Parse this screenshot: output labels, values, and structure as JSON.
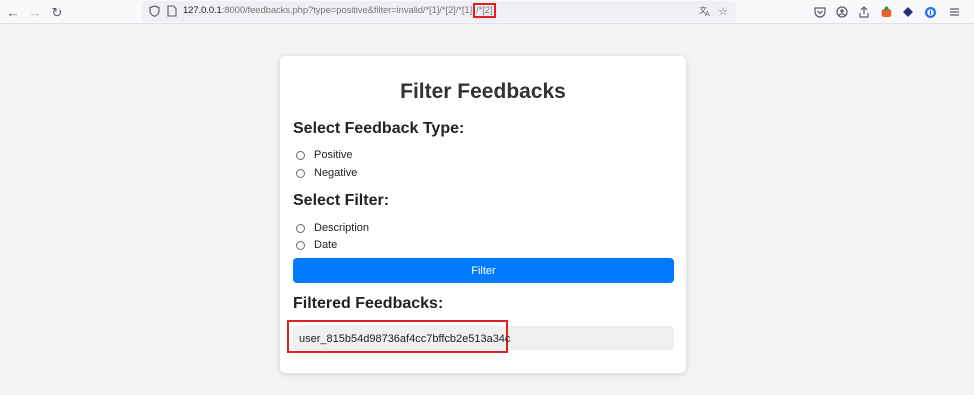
{
  "browser": {
    "url_host": "127.0.0.1",
    "url_rest": ":8000/feedbacks.php?type=positive&filter=invalid/*[1]/*[2]/*[1]",
    "url_highlight": "/*[2]",
    "icons": {
      "back": "arrow-left-icon",
      "forward": "arrow-right-icon",
      "reload": "reload-icon",
      "shield": "shield-icon",
      "page": "page-icon",
      "translate": "translate-icon",
      "bookmark": "star-icon"
    }
  },
  "form": {
    "title": "Filter Feedbacks",
    "type_heading": "Select Feedback Type:",
    "type_options": [
      "Positive",
      "Negative"
    ],
    "filter_heading": "Select Filter:",
    "filter_options": [
      "Description",
      "Date"
    ],
    "filter_button": "Filter",
    "results_heading": "Filtered Feedbacks:",
    "results": [
      "user_815b54d98736af4cc7bffcb2e513a34c"
    ]
  },
  "colors": {
    "accent": "#007bff",
    "highlight": "#e02020"
  }
}
